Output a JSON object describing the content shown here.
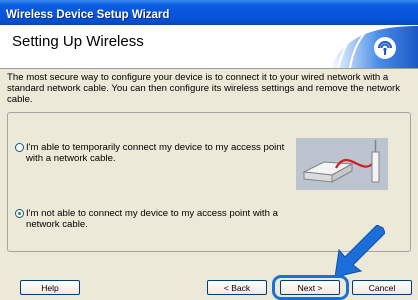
{
  "window": {
    "title": "Wireless Device Setup Wizard"
  },
  "header": {
    "title": "Setting Up Wireless",
    "icon": "wireless-signal-icon"
  },
  "description": "The most secure way to configure your device is to connect it to your wired network with a standard network cable. You can then configure its wireless settings and remove the network cable.",
  "options": [
    {
      "label": "I'm able to temporarily connect my device to my access point with a network cable.",
      "selected": false
    },
    {
      "label": "I'm not able to connect my device to my access point with a network cable.",
      "selected": true
    }
  ],
  "buttons": {
    "help": "Help",
    "back": "< Back",
    "next": "Next >",
    "cancel": "Cancel"
  },
  "colors": {
    "titlebar": "#0752d8",
    "highlight": "#1c6fd9",
    "radio_selected": "#21a121"
  }
}
